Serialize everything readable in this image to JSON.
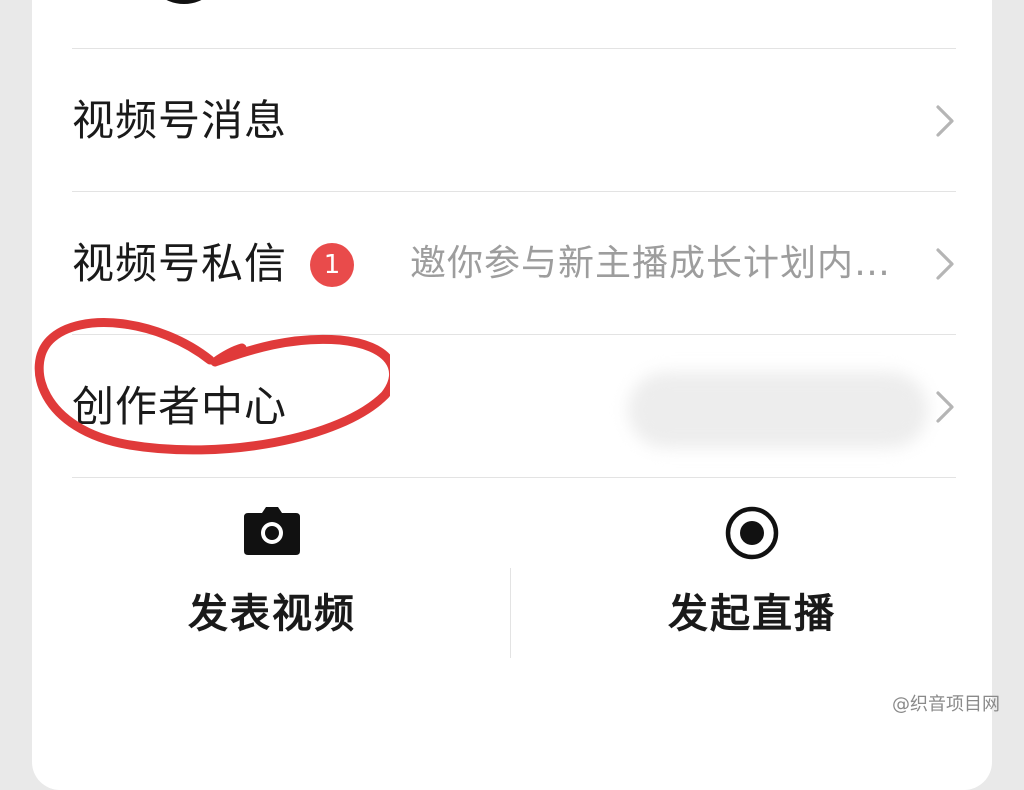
{
  "rows": [
    {
      "label": "视频号消息"
    },
    {
      "label": "视频号私信",
      "badge": "1",
      "preview": "邀你参与新主播成长计划内…"
    },
    {
      "label": "创作者中心"
    }
  ],
  "actions": {
    "publish_video": {
      "label": "发表视频",
      "icon": "camera-icon"
    },
    "start_live": {
      "label": "发起直播",
      "icon": "record-icon"
    }
  },
  "watermark": "@织音项目网",
  "colors": {
    "badge": "#e94b4b",
    "annotation": "#e03a3a"
  }
}
